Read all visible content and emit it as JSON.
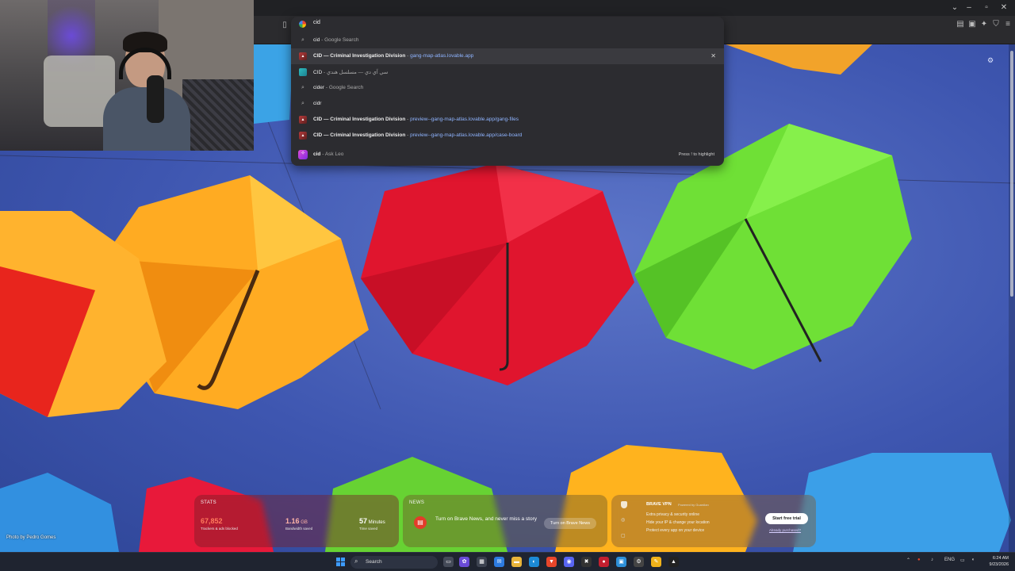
{
  "omnibox": {
    "query": "cid",
    "suggestions": [
      {
        "icon": "search-icon",
        "main": "cid",
        "sep": " - ",
        "sub": "Google Search",
        "url": ""
      },
      {
        "icon": "cid-favicon",
        "main": "CID — Criminal Investigation Division",
        "sep": " - ",
        "sub": "",
        "url": "gang-map-atlas.lovable.app"
      },
      {
        "icon": "site-favicon",
        "main": "CID",
        "sep": " - ",
        "sub": "سي آي دي — مسلسل هندي",
        "url": ""
      },
      {
        "icon": "search-icon",
        "main": "cider",
        "sep": " - ",
        "sub": "Google Search",
        "url": ""
      },
      {
        "icon": "search-icon",
        "main": "cidr",
        "sep": "",
        "sub": "",
        "url": ""
      },
      {
        "icon": "cid-favicon",
        "main": "CID — Criminal Investigation Division",
        "sep": " - ",
        "sub": "",
        "url": "preview--gang-map-atlas.lovable.app/gang-files"
      },
      {
        "icon": "cid-favicon",
        "main": "CID — Criminal Investigation Division",
        "sep": " - ",
        "sub": "",
        "url": "preview--gang-map-atlas.lovable.app/case-board"
      },
      {
        "icon": "leo-icon",
        "main": "cid",
        "sep": " - ",
        "sub": "Ask Leo",
        "url": ""
      }
    ],
    "remove_glyph": "✕",
    "hint": "Press ! to highlight"
  },
  "page": {
    "photo_credit": "Photo by Pedro Gomes"
  },
  "stats": {
    "title": "STATS",
    "items": [
      {
        "value": "67,852",
        "unit": "",
        "label": "Trackers & ads blocked",
        "color": "#ff7a5c"
      },
      {
        "value": "1.16",
        "unit": " GB",
        "label": "Bandwidth saved",
        "color": "#ffb4a8"
      },
      {
        "value": "57",
        "unit": " Minutes",
        "label": "Time saved",
        "color": "#ffffff"
      }
    ]
  },
  "news": {
    "title": "NEWS",
    "text": "Turn on Brave News, and never miss a story",
    "button": "Turn on Brave News"
  },
  "vpn": {
    "title": "BRAVE VPN",
    "powered": "Powered by Guardian",
    "features": [
      "Extra privacy & security online",
      "Hide your IP & change your location",
      "Protect every app on your device"
    ],
    "button": "Start free trial",
    "link": "Already purchased?"
  },
  "taskbar": {
    "search_label": "Search",
    "lang": "ENG",
    "time": "6:24 AM",
    "date": "9/23/2026"
  },
  "colors": {
    "accent": "#3d9bff",
    "omnibox_bg": "#2c2c30",
    "url_text": "#8fb4ff"
  }
}
